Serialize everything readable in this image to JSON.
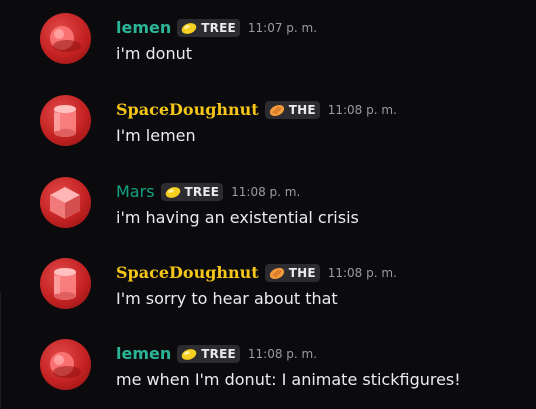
{
  "colors": {
    "background": "#0b0b0e",
    "lemen": "#2bb596",
    "spacedoughnut": "#f5c518",
    "mars": "#17a383",
    "tag_bg": "#2b2b30",
    "timestamp": "#9a9aa2",
    "text": "#ececef"
  },
  "messages": [
    {
      "username": "lemen",
      "tag": "TREE",
      "tag_icon": "lemon-icon",
      "timestamp": "11:07 p. m.",
      "text": "i'm donut",
      "avatar": "donut-avatar"
    },
    {
      "username": "SpaceDoughnut",
      "tag": "THE",
      "tag_icon": "bread-icon",
      "timestamp": "11:08 p. m.",
      "text": "I'm lemen",
      "avatar": "cylinder-avatar"
    },
    {
      "username": "Mars",
      "tag": "TREE",
      "tag_icon": "lemon-icon",
      "timestamp": "11:08 p. m.",
      "text": "i'm having an existential crisis",
      "avatar": "cube-avatar"
    },
    {
      "username": "SpaceDoughnut",
      "tag": "THE",
      "tag_icon": "bread-icon",
      "timestamp": "11:08 p. m.",
      "text": "I'm sorry to hear about that",
      "avatar": "cylinder-avatar"
    },
    {
      "username": "lemen",
      "tag": "TREE",
      "tag_icon": "lemon-icon",
      "timestamp": "11:08 p. m.",
      "text": "me when I'm donut: I animate stickfigures!",
      "avatar": "donut-avatar"
    }
  ]
}
